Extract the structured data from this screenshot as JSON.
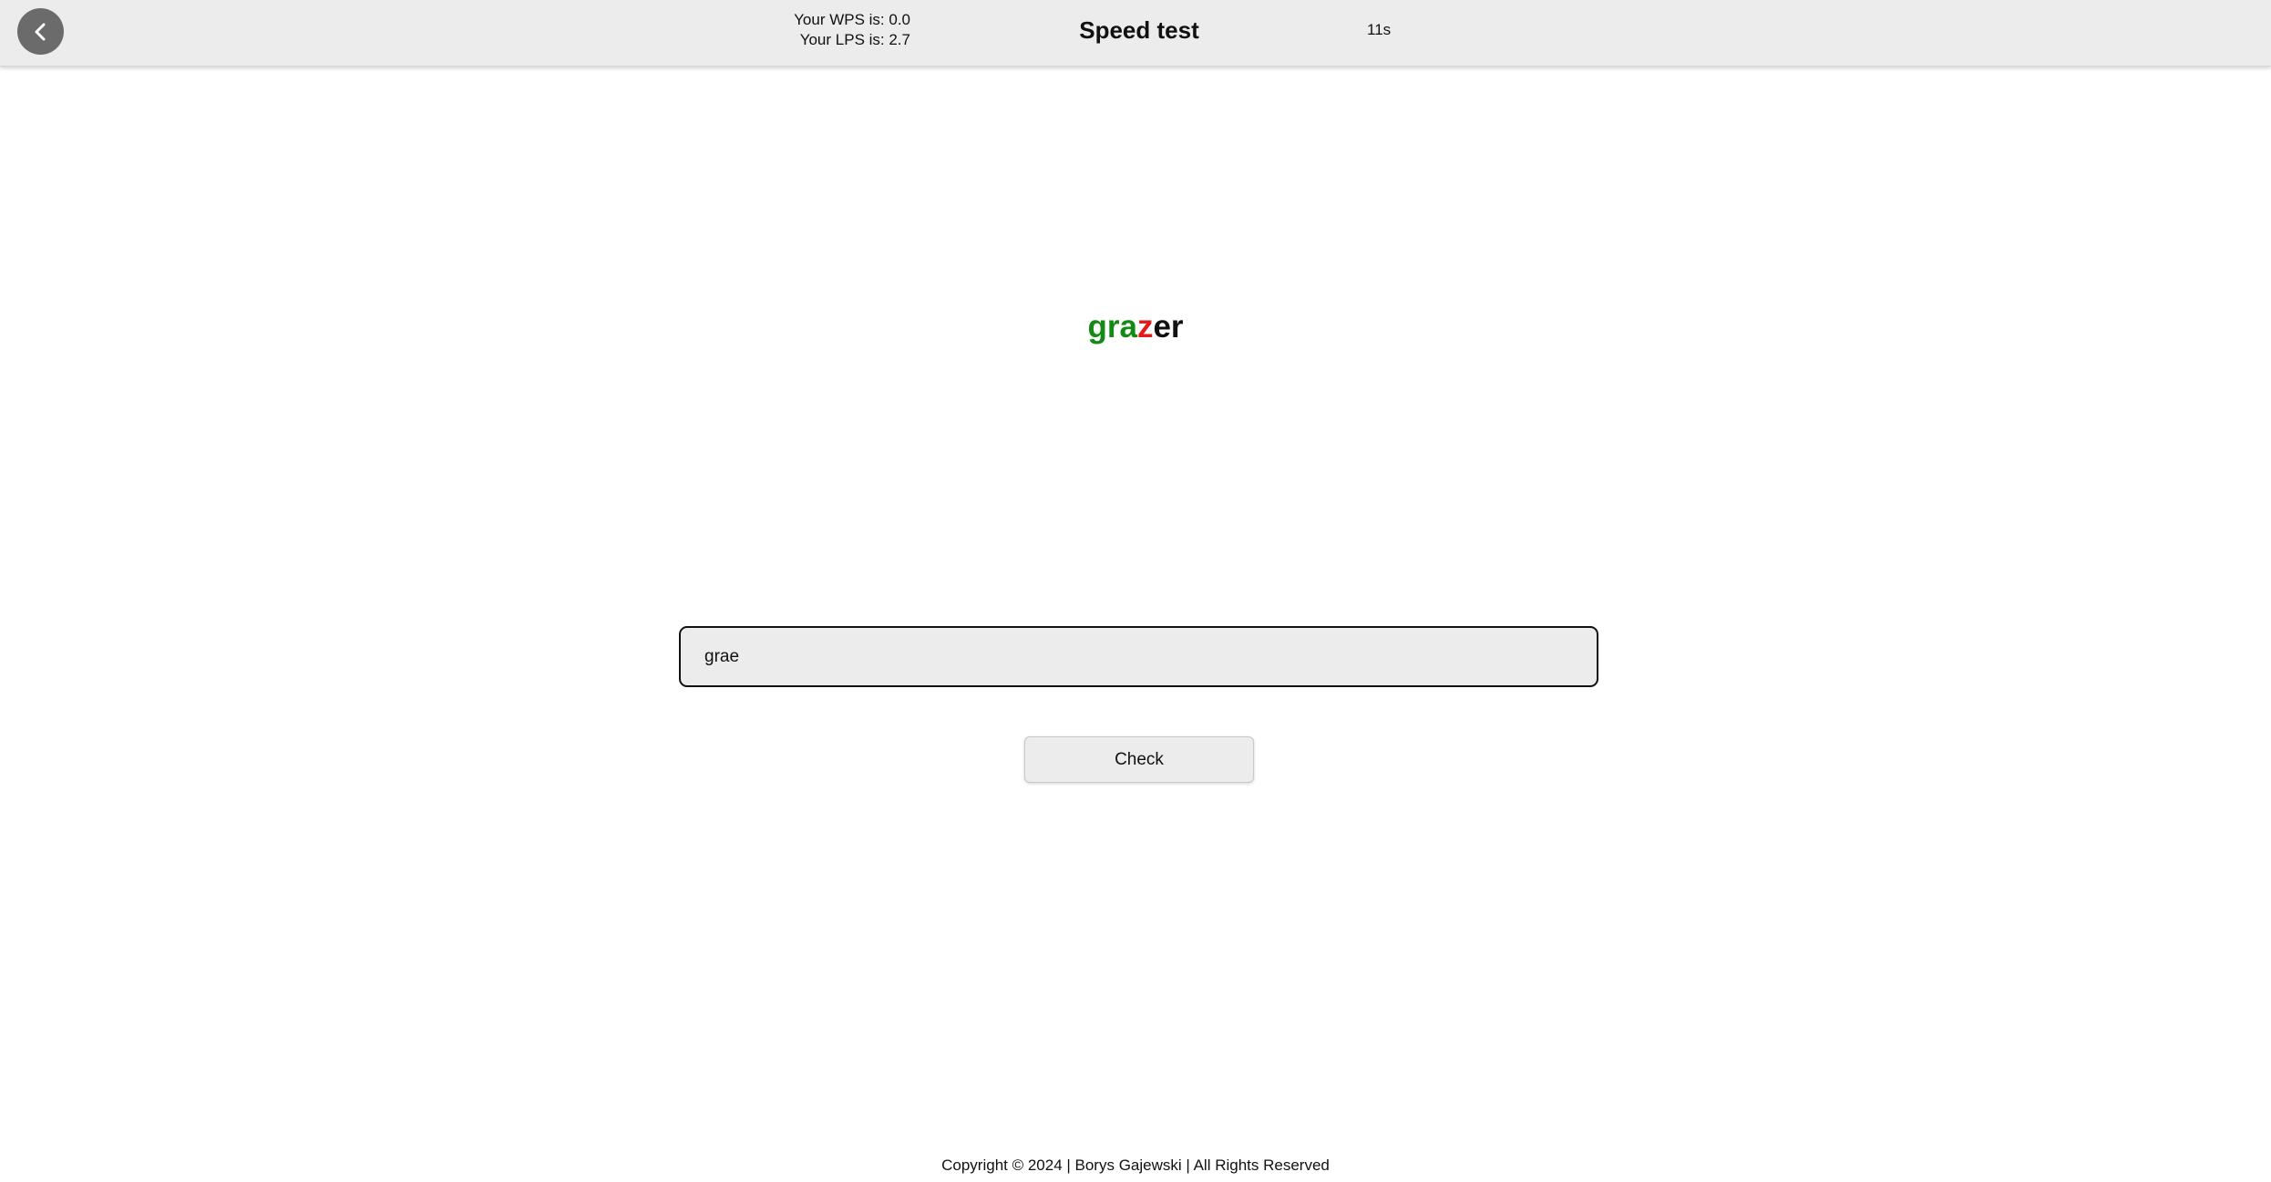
{
  "header": {
    "back_icon": "chevron-left-icon",
    "wps_text": "Your WPS is: 0.0",
    "lps_text": "Your LPS is: 2.7",
    "title": "Speed test",
    "timer": "11s"
  },
  "challenge": {
    "word_correct": "gra",
    "word_wrong": "z",
    "word_rest": "er",
    "colors": {
      "correct": "#138a13",
      "wrong": "#e21a1a",
      "pending": "#111111"
    }
  },
  "answer": {
    "value": "grae"
  },
  "check_button": {
    "label": "Check"
  },
  "footer": {
    "copyright": "Copyright © 2024 | Borys Gajewski | All Rights Reserved"
  }
}
